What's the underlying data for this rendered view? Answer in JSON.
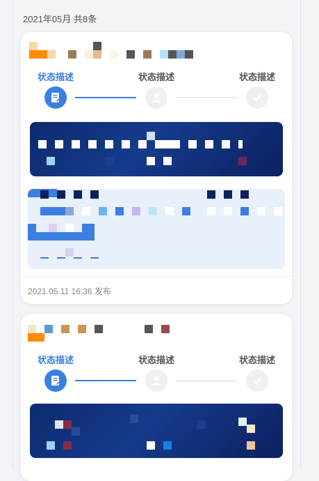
{
  "list": {
    "header": "2021年05月 共8条"
  },
  "cards": [
    {
      "steps": [
        {
          "label": "状态描述",
          "state": "active",
          "icon": "edit-doc-icon"
        },
        {
          "label": "状态描述",
          "state": "inactive",
          "icon": "person-icon"
        },
        {
          "label": "状态描述",
          "state": "inactive",
          "icon": "check-icon"
        }
      ],
      "publish_time": "2021.05.11 16:36 发布"
    },
    {
      "steps": [
        {
          "label": "状态描述",
          "state": "active",
          "icon": "edit-doc-icon"
        },
        {
          "label": "状态描述",
          "state": "inactive",
          "icon": "person-icon"
        },
        {
          "label": "状态描述",
          "state": "inactive",
          "icon": "check-icon"
        }
      ]
    }
  ],
  "colors": {
    "accent": "#3b7fe0",
    "banner": "#0e2a6e",
    "info_bg": "#e8f0fb",
    "orange": "#ff8c00"
  }
}
